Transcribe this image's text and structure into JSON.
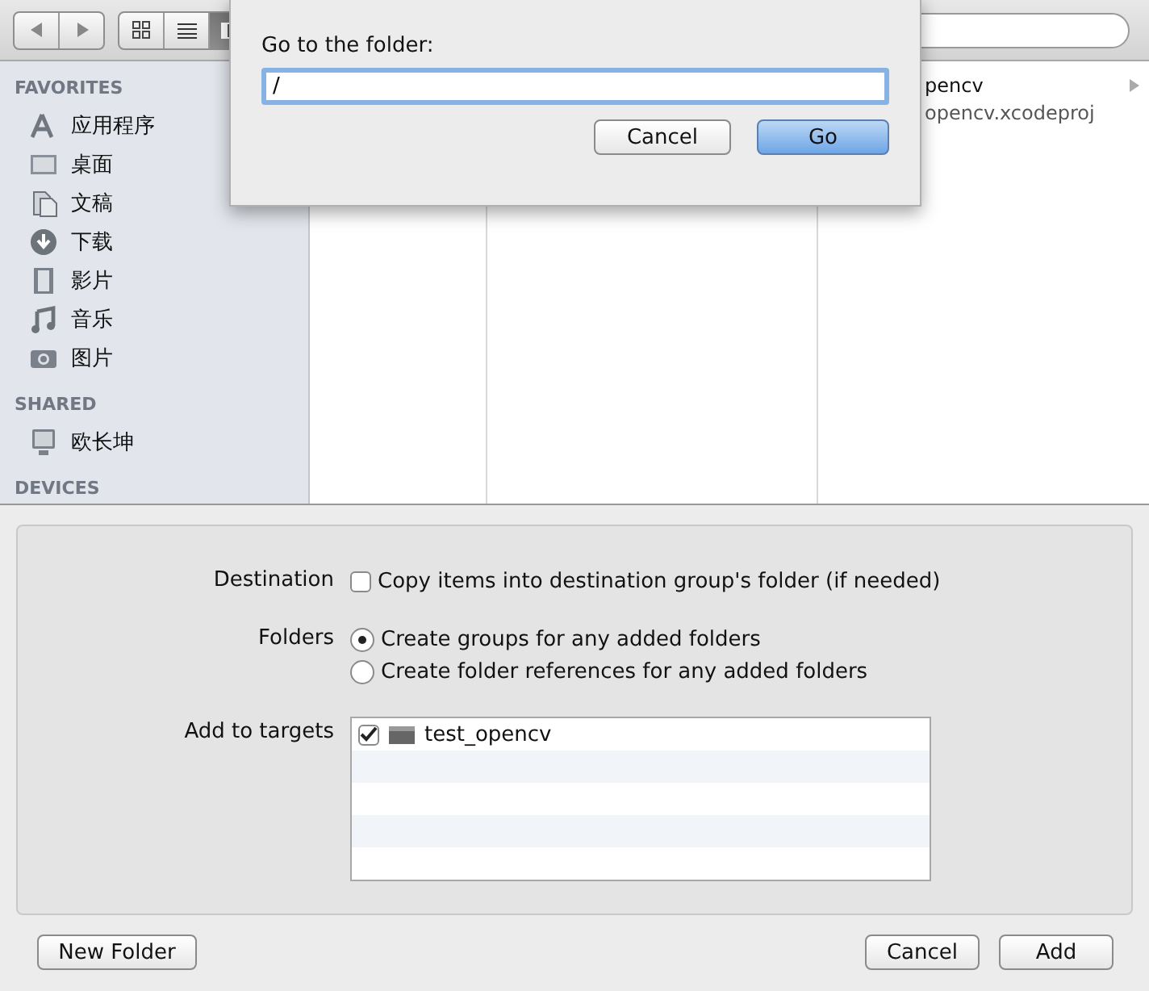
{
  "toolbar": {
    "view_modes": [
      {
        "kind": "icons",
        "selected": false
      },
      {
        "kind": "list",
        "selected": false
      },
      {
        "kind": "columns",
        "selected": true
      }
    ]
  },
  "sidebar": {
    "sections": [
      {
        "title": "FAVORITES",
        "items": [
          {
            "label": "应用程序",
            "kind": "apps"
          },
          {
            "label": "桌面",
            "kind": "desktop"
          },
          {
            "label": "文稿",
            "kind": "docs"
          },
          {
            "label": "下载",
            "kind": "download"
          },
          {
            "label": "影片",
            "kind": "movies"
          },
          {
            "label": "音乐",
            "kind": "music"
          },
          {
            "label": "图片",
            "kind": "pictures"
          }
        ]
      },
      {
        "title": "SHARED",
        "items": [
          {
            "label": "欧长坤",
            "kind": "computer"
          }
        ]
      },
      {
        "title": "DEVICES"
      }
    ]
  },
  "browser": {
    "column_3": [
      {
        "name": "pencv",
        "has_children": true
      },
      {
        "name": "opencv.xcodeproj",
        "has_children": false
      }
    ]
  },
  "options": {
    "destination": {
      "label": "Destination",
      "option": "Copy items into destination group's folder (if needed)",
      "checked": false
    },
    "folders": {
      "label": "Folders",
      "options": [
        {
          "label": "Create groups for any added folders",
          "selected": true
        },
        {
          "label": "Create folder references for any added folders",
          "selected": false
        }
      ]
    },
    "targets": {
      "label": "Add to targets",
      "items": [
        {
          "name": "test_opencv",
          "checked": true
        }
      ]
    }
  },
  "footer": {
    "new_folder": "New Folder",
    "cancel": "Cancel",
    "add": "Add"
  },
  "go_dialog": {
    "title": "Go to the folder:",
    "value": "/",
    "cancel": "Cancel",
    "go": "Go"
  }
}
